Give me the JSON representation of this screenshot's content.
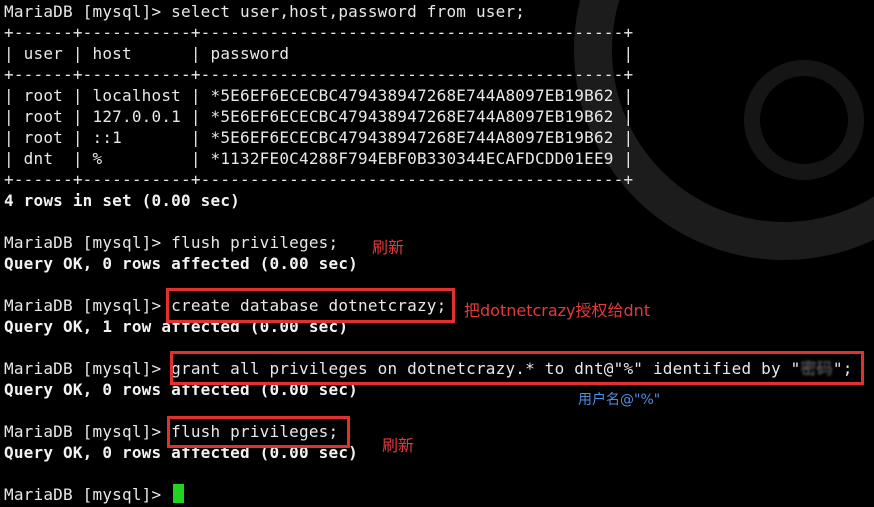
{
  "terminal": {
    "lines": [
      "MariaDB [mysql]> select user,host,password from user;",
      "+------+-----------+-------------------------------------------+",
      "| user | host      | password                                  |",
      "+------+-----------+-------------------------------------------+",
      "| root | localhost | *5E6EF6ECECBC479438947268E744A8097EB19B62 |",
      "| root | 127.0.0.1 | *5E6EF6ECECBC479438947268E744A8097EB19B62 |",
      "| root | ::1       | *5E6EF6ECECBC479438947268E744A8097EB19B62 |",
      "| dnt  | %         | *1132FE0C4288F794EBF0B330344ECAFDCDD01EE9 |",
      "+------+-----------+-------------------------------------------+",
      "4 rows in set (0.00 sec)",
      "MariaDB [mysql]> flush privileges;",
      "Query OK, 0 rows affected (0.00 sec)",
      "MariaDB [mysql]> create database dotnetcrazy;",
      "Query OK, 1 row affected (0.00 sec)",
      "MariaDB [mysql]> grant all privileges on dotnetcrazy.* to dnt@\"%\" identified by \"",
      "\";",
      "Query OK, 0 rows affected (0.00 sec)",
      "MariaDB [mysql]> flush privileges;",
      "Query OK, 0 rows affected (0.00 sec)",
      "MariaDB [mysql]> "
    ],
    "redacted_password": "密码"
  },
  "annotations": {
    "refresh_1": "刷新",
    "grant_db": "把dotnetcrazy授权给dnt",
    "user_at": "用户名@\"%\"",
    "refresh_2": "刷新"
  },
  "colors": {
    "annotation_red": "#e23b3b",
    "annotation_blue": "#4a90e2",
    "cursor": "#22d422",
    "highlight_box": "#e03030"
  }
}
